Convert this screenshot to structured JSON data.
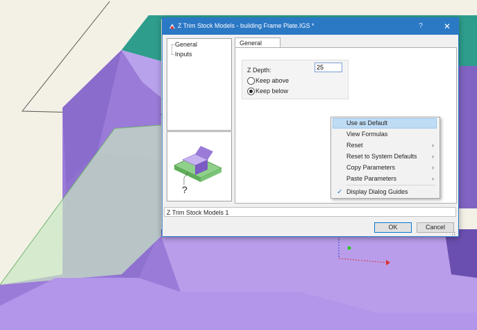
{
  "colors": {
    "titlebar": "#2b78c5",
    "menu_highlight": "#bfdcf4",
    "teal_surface": "#2e9d8c",
    "purple_surface": "#9a7bd8"
  },
  "window": {
    "title": "Z Trim Stock Models - building Frame Plate.IGS *",
    "help_glyph": "?",
    "close_glyph": "✕"
  },
  "tree": {
    "items": [
      "General",
      "Inputs"
    ]
  },
  "preview": {
    "glyph": "?"
  },
  "tab": {
    "label": "General"
  },
  "form": {
    "zdepth_label": "Z Depth:",
    "zdepth_value": "25",
    "keep_above_label": "Keep above",
    "keep_below_label": "Keep below",
    "selected": "Keep below"
  },
  "statusbar": {
    "text": "Z Trim Stock Models 1"
  },
  "buttons": {
    "ok": "OK",
    "cancel": "Cancel"
  },
  "context_menu": {
    "items": [
      {
        "label": "Use as Default",
        "arrow": "",
        "highlighted": true
      },
      {
        "label": "View Formulas",
        "arrow": ""
      },
      {
        "label": "Reset",
        "arrow": "›"
      },
      {
        "label": "Reset to System Defaults",
        "arrow": "›"
      },
      {
        "label": "Copy Parameters",
        "arrow": "›"
      },
      {
        "label": "Paste Parameters",
        "arrow": "›"
      },
      {
        "label": "Display Dialog Guides",
        "arrow": "",
        "checked": true
      }
    ],
    "check_glyph": "✓"
  }
}
